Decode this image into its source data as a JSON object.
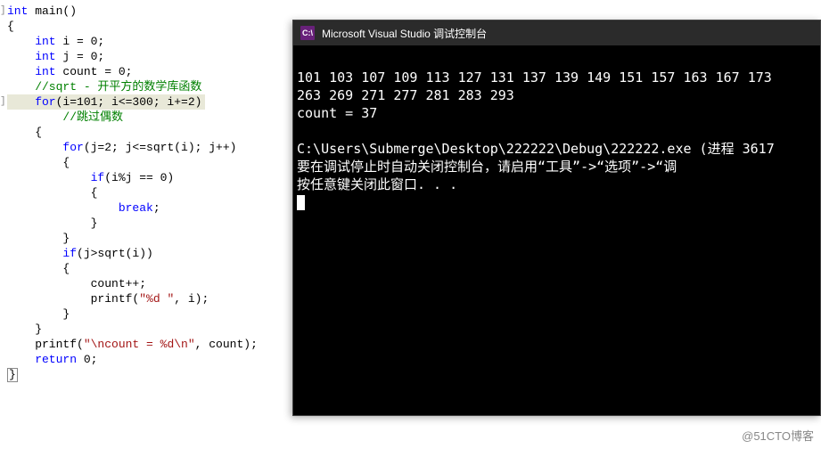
{
  "code": {
    "l1_a": "int",
    "l1_b": " main()",
    "l2": "{",
    "l3_a": "    int",
    "l3_b": " i = 0;",
    "l4_a": "    int",
    "l4_b": " j = 0;",
    "l5_a": "    int",
    "l5_b": " count = 0;",
    "l6": "    //sqrt - 开平方的数学库函数",
    "l7_a": "    for",
    "l7_b": "(i=101; i<=300; i+=2)",
    "l8": "        //跳过偶数",
    "l9": "    {",
    "l10": "",
    "l11_a": "        for",
    "l11_b": "(j=2; j<=sqrt(i); j++)",
    "l12": "        {",
    "l13_a": "            if",
    "l13_b": "(i%j == 0)",
    "l14": "            {",
    "l15_a": "                break",
    "l15_b": ";",
    "l16": "            }",
    "l17": "        }",
    "l18_a": "        if",
    "l18_b": "(j>sqrt(i))",
    "l19": "        {",
    "l20": "            count++;",
    "l21_a": "            printf(",
    "l21_b": "\"%d \"",
    "l21_c": ", i);",
    "l22": "        }",
    "l23": "    }",
    "l24_a": "    printf(",
    "l24_b": "\"\\ncount = %d\\n\"",
    "l24_c": ", count);",
    "l25_a": "    return",
    "l25_b": " 0;",
    "l26": "}"
  },
  "console": {
    "title": "Microsoft Visual Studio 调试控制台",
    "icon_text": "C:\\",
    "line1": "101 103 107 109 113 127 131 137 139 149 151 157 163 167 173",
    "line2": "263 269 271 277 281 283 293",
    "line3": "count = 37",
    "blank": "",
    "line4": "C:\\Users\\Submerge\\Desktop\\222222\\Debug\\222222.exe (进程 3617",
    "line5": "要在调试停止时自动关闭控制台，请启用“工具”->“选项”->“调",
    "line6": "按任意键关闭此窗口. . ."
  },
  "watermark": "@51CTO博客"
}
